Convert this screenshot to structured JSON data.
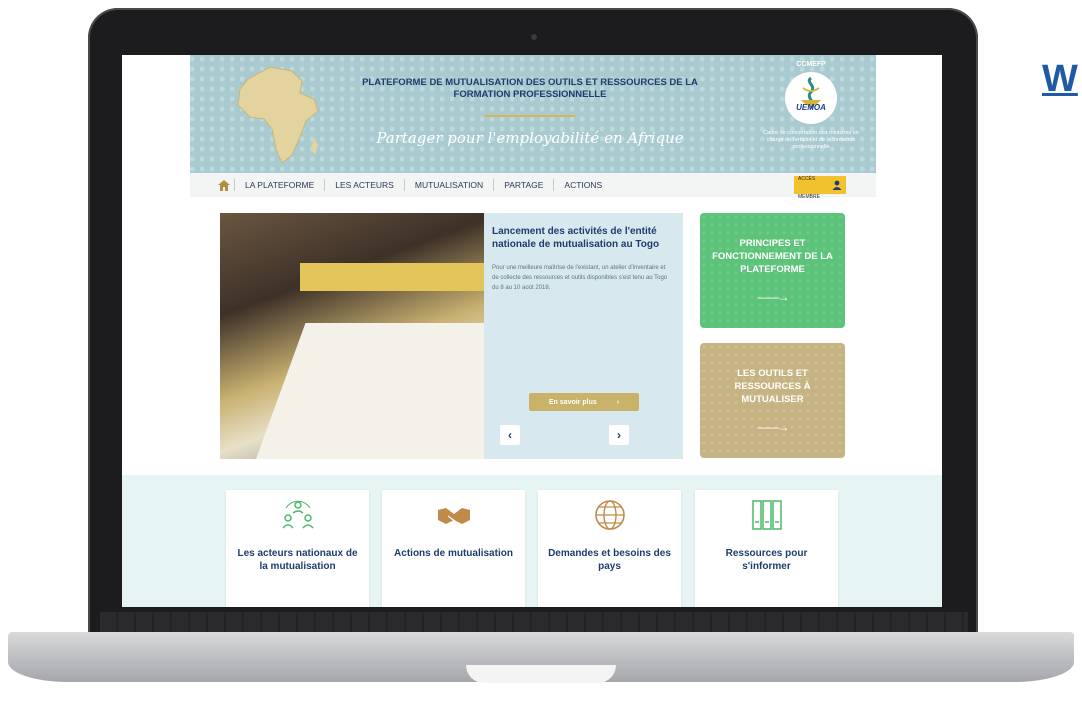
{
  "header": {
    "title": "PLATEFORME DE MUTUALISATION DES OUTILS ET RESSOURCES DE LA FORMATION PROFESSIONNELLE",
    "tagline": "Partager pour l'employabilité en Afrique",
    "org_acronym": "CCMEFP",
    "org_name": "UEMOA",
    "org_description": "Cadre de concertation des ministres en charge de l'emploi et de la formation professionnelle"
  },
  "nav": {
    "home_icon": "home-icon",
    "items": [
      "LA PLATEFORME",
      "LES ACTEURS",
      "MUTUALISATION",
      "PARTAGE",
      "ACTIONS"
    ],
    "member_line1": "ACCÈS",
    "member_line2": "MEMBRE",
    "member_icon": "user-icon"
  },
  "slider": {
    "title": "Lancement des activités de l'entité nationale de mutualisation au Togo",
    "text": "Pour une meilleure maîtrise de l'existant, un atelier d'inventaire et de collecte des ressources et outils disponibles s'est tenu au Togo du 8 au 10 août 2018.",
    "more": "En savoir plus",
    "prev": "‹",
    "next": "›"
  },
  "tiles": [
    {
      "label": "PRINCIPES ET FONCTIONNEMENT DE LA PLATEFORME",
      "arrow": "——→"
    },
    {
      "label": "LES OUTILS ET RESSOURCES À MUTUALISER",
      "arrow": "——→"
    }
  ],
  "cards": [
    {
      "label": "Les acteurs nationaux de la mutualisation",
      "icon": "people-network-icon"
    },
    {
      "label": "Actions de mutualisation",
      "icon": "handshake-icon"
    },
    {
      "label": "Demandes et besoins des pays",
      "icon": "globe-icon"
    },
    {
      "label": "Ressources pour s'informer",
      "icon": "binders-icon"
    }
  ],
  "edge_text": "W",
  "colors": {
    "header_bg": "#a9cbd0",
    "navy": "#1e3c6e",
    "green_tile": "#5dc27a",
    "sand_tile": "#c5b384",
    "gold": "#c9b26a",
    "band_bg": "#e7f4f4"
  }
}
